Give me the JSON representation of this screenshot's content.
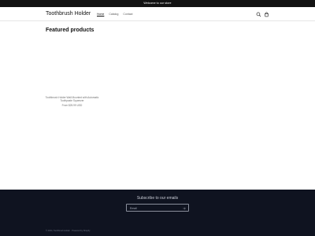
{
  "announcement": {
    "text": "Welcome to our store"
  },
  "header": {
    "logo": "Toothbrush Holder",
    "nav": [
      {
        "label": "Home",
        "active": true
      },
      {
        "label": "Catalog",
        "active": false
      },
      {
        "label": "Contact",
        "active": false
      }
    ],
    "icons": [
      "search-icon",
      "cart-icon"
    ]
  },
  "main": {
    "featured_title": "Featured products",
    "product": {
      "title": "Toothbrush Holder Wall Mounted with Automatic Toothpaste Squeezer",
      "price": "From $25.99 USD"
    }
  },
  "footer": {
    "subscribe_title": "Subscribe to our emails",
    "email_placeholder": "Email",
    "copyright": "© 2024, Toothbrush Holder · Powered by Shopify"
  }
}
